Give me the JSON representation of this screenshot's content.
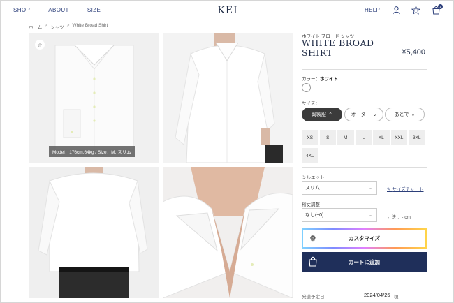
{
  "header": {
    "nav": [
      "SHOP",
      "ABOUT",
      "SIZE"
    ],
    "logo": "KEI",
    "help": "HELP",
    "icons": [
      "user-icon",
      "star-icon",
      "cart-icon"
    ],
    "cart_count": "1"
  },
  "breadcrumb": [
    "ホーム",
    "シャツ",
    "White Broad Shirt"
  ],
  "breadcrumb_sep": ">",
  "gallery": {
    "model_caption": "Model：176cm,64kg / Size：M, スリム",
    "favorite_icon": "star-icon"
  },
  "product": {
    "subtitle": "ホワイト ブロード シャツ",
    "title": "WHITE BROAD SHIRT",
    "price": "¥5,400"
  },
  "color": {
    "label": "カラー：",
    "value": "ホワイト",
    "swatch": "#ffffff"
  },
  "size": {
    "label": "サイズ：",
    "modes": [
      {
        "label": "既製服",
        "chevron": "^",
        "active": true
      },
      {
        "label": "オーダー",
        "chevron": "v",
        "active": false
      },
      {
        "label": "あとで",
        "chevron": "v",
        "active": false
      }
    ],
    "options_row1": [
      "XS",
      "S",
      "M",
      "L",
      "XL",
      "XXL",
      "3XL"
    ],
    "options_row2": [
      "4XL"
    ]
  },
  "silhouette": {
    "label": "シルエット",
    "value": "スリム",
    "size_chart": "サイズチャート"
  },
  "length": {
    "label": "裄丈調整",
    "value": "なし(±0)",
    "dims": "寸法 ：- cm"
  },
  "buttons": {
    "customize": "カスタマイズ",
    "add_to_cart": "カートに追加"
  },
  "shipping": {
    "label": "発送予定日",
    "date": "2024/04/25",
    "suffix": "頃"
  },
  "colors": {
    "navy": "#1f2f5a",
    "active_pill": "#3b3b3b"
  }
}
